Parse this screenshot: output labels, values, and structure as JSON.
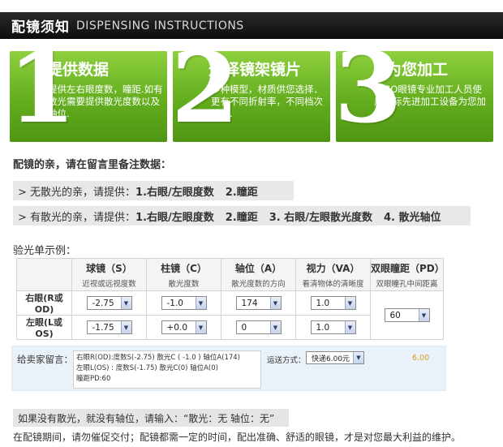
{
  "header": {
    "title_cn": "配镜须知",
    "title_en": "DISPENSING INSTRUCTIONS"
  },
  "steps": [
    {
      "num": "1",
      "title": "提供数据",
      "desc": "提供左右眼度数，瞳距.如有散光需要提供散光度数以及轴位."
    },
    {
      "num": "2",
      "title": "选择镜架镜片",
      "desc": "多种模型，材质供您选择．更有不同折射率，不同档次镜片."
    },
    {
      "num": "3",
      "title": "为您加工",
      "desc": "RIGO眼镜专业加工人员使用国际先进加工设备为您加工."
    }
  ],
  "section_title": "配镜的亲，请在留言里备注数据：",
  "req_no_astig": {
    "prefix": "> 无散光的亲，请提供：",
    "item1": "1.右眼/左眼度数",
    "item2": "2.瞳距"
  },
  "req_astig": {
    "prefix": "> 有散光的亲，请提供：",
    "item1": "1.右眼/左眼度数",
    "item2": "2.瞳距",
    "item3": "3. 右眼/左眼散光度数",
    "item4": "4. 散光轴位"
  },
  "example_title": "验光单示例：",
  "table": {
    "headers": [
      {
        "main": "球镜（S）",
        "sub": "近视或远视度数"
      },
      {
        "main": "柱镜（C）",
        "sub": "散光度数"
      },
      {
        "main": "轴位（A）",
        "sub": "散光度数的方向"
      },
      {
        "main": "视力（VA）",
        "sub": "看清物体的清晰度"
      },
      {
        "main": "双眼瞳距（PD）",
        "sub": "双眼瞳孔中间距离"
      }
    ],
    "rows": [
      {
        "label": "右眼(R或OD)",
        "s": "-2.75",
        "c": "-1.0",
        "a": "174",
        "va": "1.0"
      },
      {
        "label": "左眼(L或OS)",
        "s": "-1.75",
        "c": "+0.0",
        "a": "0",
        "va": "1.0"
      }
    ],
    "pd": "60"
  },
  "message": {
    "label": "给卖家留言：",
    "line1": "右眼R(OD):度数S(-2.75) 散光C ( -1.0 ) 轴位A(174)",
    "line2": "左眼L(OS) : 度数S(-1.75) 散光C(0) 轴位A(0)",
    "line3": "瞳距PD:60",
    "shipping_label": "运送方式：",
    "shipping_value": "快递6.00元",
    "price": "6.00"
  },
  "note": "如果没有散光，就没有轴位，请输入：“散光：无     轴位：无”",
  "bottom_text": "在配镜期间，请勿催促交付；配镜都需一定的时间，配出准确、舒适的眼镜，才是对您最大利益的维护。"
}
